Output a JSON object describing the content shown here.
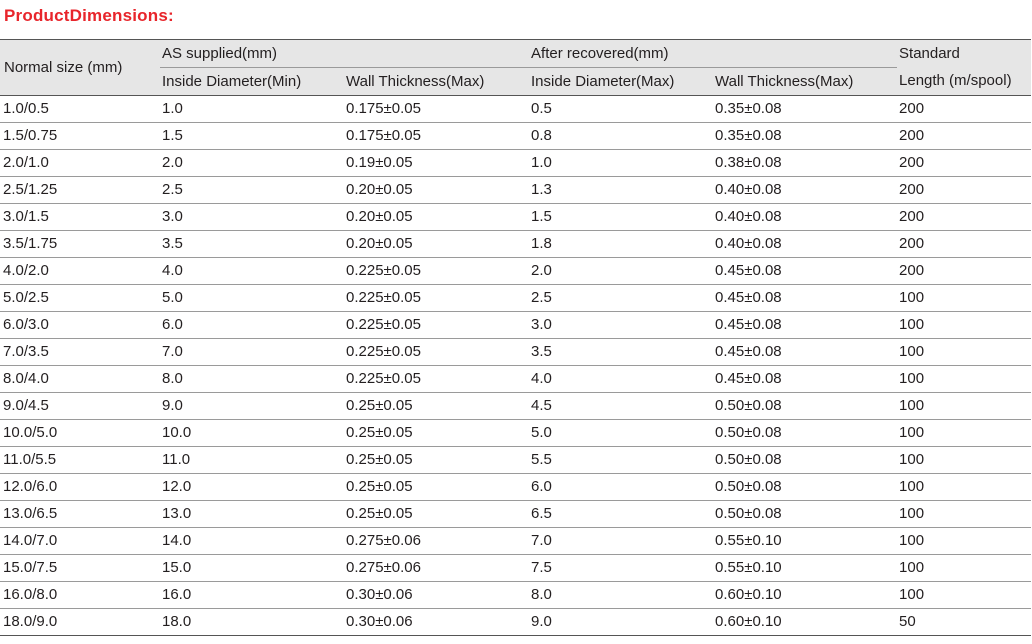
{
  "title": "ProductDimensions:",
  "headers": {
    "normal_size": "Normal size (mm)",
    "as_supplied": "AS supplied(mm)",
    "after_recovered": "After recovered(mm)",
    "standard": "Standard",
    "as_inside": "Inside Diameter(Min)",
    "as_wall": "Wall Thickness(Max)",
    "ar_inside": "Inside Diameter(Max)",
    "ar_wall": "Wall Thickness(Max)",
    "length": "Length (m/spool)"
  },
  "rows": [
    [
      "1.0/0.5",
      "1.0",
      "0.175±0.05",
      "0.5",
      "0.35±0.08",
      "200"
    ],
    [
      "1.5/0.75",
      "1.5",
      "0.175±0.05",
      "0.8",
      "0.35±0.08",
      "200"
    ],
    [
      "2.0/1.0",
      "2.0",
      "0.19±0.05",
      "1.0",
      "0.38±0.08",
      "200"
    ],
    [
      "2.5/1.25",
      "2.5",
      "0.20±0.05",
      "1.3",
      "0.40±0.08",
      "200"
    ],
    [
      "3.0/1.5",
      "3.0",
      "0.20±0.05",
      "1.5",
      "0.40±0.08",
      "200"
    ],
    [
      "3.5/1.75",
      "3.5",
      "0.20±0.05",
      "1.8",
      "0.40±0.08",
      "200"
    ],
    [
      "4.0/2.0",
      "4.0",
      "0.225±0.05",
      "2.0",
      "0.45±0.08",
      "200"
    ],
    [
      "5.0/2.5",
      "5.0",
      "0.225±0.05",
      "2.5",
      "0.45±0.08",
      "100"
    ],
    [
      "6.0/3.0",
      "6.0",
      "0.225±0.05",
      "3.0",
      "0.45±0.08",
      "100"
    ],
    [
      "7.0/3.5",
      "7.0",
      "0.225±0.05",
      "3.5",
      "0.45±0.08",
      "100"
    ],
    [
      "8.0/4.0",
      "8.0",
      "0.225±0.05",
      "4.0",
      "0.45±0.08",
      "100"
    ],
    [
      "9.0/4.5",
      "9.0",
      "0.25±0.05",
      "4.5",
      "0.50±0.08",
      "100"
    ],
    [
      "10.0/5.0",
      "10.0",
      "0.25±0.05",
      "5.0",
      "0.50±0.08",
      "100"
    ],
    [
      "11.0/5.5",
      "11.0",
      "0.25±0.05",
      "5.5",
      "0.50±0.08",
      "100"
    ],
    [
      "12.0/6.0",
      "12.0",
      "0.25±0.05",
      "6.0",
      "0.50±0.08",
      "100"
    ],
    [
      "13.0/6.5",
      "13.0",
      "0.25±0.05",
      "6.5",
      "0.50±0.08",
      "100"
    ],
    [
      "14.0/7.0",
      "14.0",
      "0.275±0.06",
      "7.0",
      "0.55±0.10",
      "100"
    ],
    [
      "15.0/7.5",
      "15.0",
      "0.275±0.06",
      "7.5",
      "0.55±0.10",
      "100"
    ],
    [
      "16.0/8.0",
      "16.0",
      "0.30±0.06",
      "8.0",
      "0.60±0.10",
      "100"
    ],
    [
      "18.0/9.0",
      "18.0",
      "0.30±0.06",
      "9.0",
      "0.60±0.10",
      "50"
    ]
  ],
  "colors": {
    "title": "#e8252b",
    "header_bg": "#e6e6e6",
    "text": "#231f20"
  }
}
